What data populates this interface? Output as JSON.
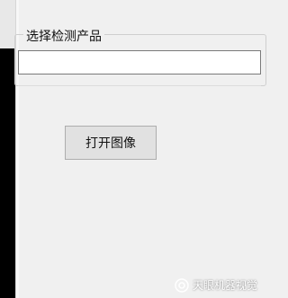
{
  "group": {
    "title": "选择检测产品"
  },
  "product_select": {
    "value": ""
  },
  "open_image_button": {
    "label": "打开图像"
  },
  "watermark": {
    "text": "天眼机器视觉",
    "icon": "wechat-channel-icon"
  }
}
